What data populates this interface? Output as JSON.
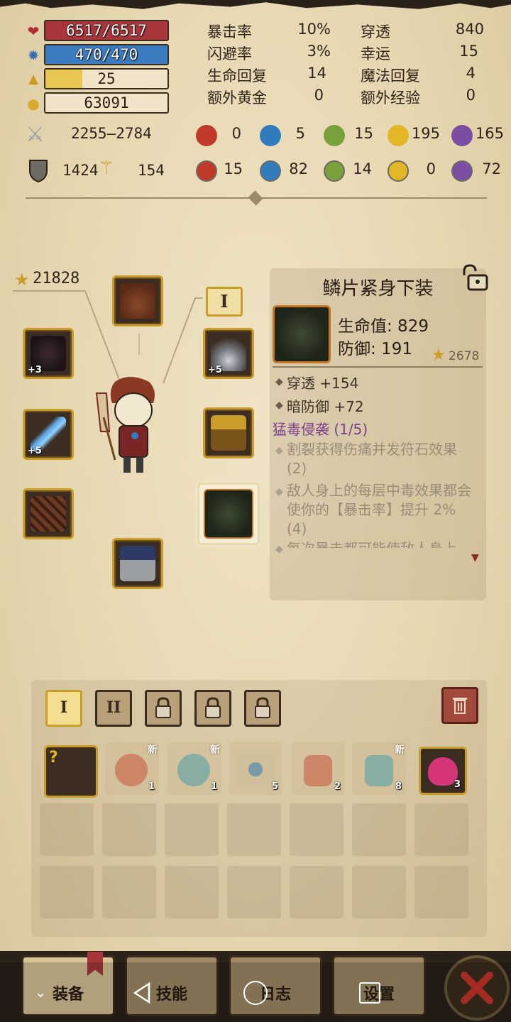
{
  "resources": {
    "hp": "6517/6517",
    "mp": "470/470",
    "level": "25",
    "gold": "63091",
    "level_progress": 0.3
  },
  "stats": [
    {
      "label": "暴击率",
      "value": "10%"
    },
    {
      "label": "穿透",
      "value": "840"
    },
    {
      "label": "闪避率",
      "value": "3%"
    },
    {
      "label": "幸运",
      "value": "15"
    },
    {
      "label": "生命回复",
      "value": "14"
    },
    {
      "label": "魔法回复",
      "value": "4"
    },
    {
      "label": "额外黄金",
      "value": "0"
    },
    {
      "label": "额外经验",
      "value": "0"
    }
  ],
  "attack": "2255–2784",
  "defense": "1424",
  "magic_defense": "154",
  "element_attack": [
    "0",
    "5",
    "15",
    "195",
    "165"
  ],
  "element_defense": [
    "15",
    "82",
    "14",
    "0",
    "72"
  ],
  "character": {
    "score": "21828",
    "slot_badge": "I"
  },
  "equipment_plus": {
    "left_top": "+3",
    "left_mid": "+5",
    "right_top": "+5"
  },
  "item_detail": {
    "name": "鳞片紧身下装",
    "hp": "生命值: 829",
    "def": "防御: 191",
    "score": "2678",
    "bonus1": "穿透 +154",
    "bonus2": "暗防御 +72",
    "set": "猛毒侵袭 (1/5)",
    "desc1": "割裂获得伤痛并发符石效果 (2)",
    "desc2": "敌人身上的每层中毒效果都会使你的【暴击率】提升 2% (4)",
    "desc3": "每次暴击都可能使敌人身上"
  },
  "inventory": {
    "tabs": [
      "I",
      "II"
    ],
    "new_label": "新",
    "counts": [
      "1",
      "1",
      "5",
      "2",
      "8",
      "3"
    ]
  },
  "nav": {
    "equip": "装备",
    "skills": "技能",
    "log": "日志",
    "settings": "设置"
  },
  "colors": {
    "hp": "#a8363a",
    "mp": "#3b7bbf",
    "xp": "#e8c853",
    "gold_border": "#c99d2a"
  }
}
